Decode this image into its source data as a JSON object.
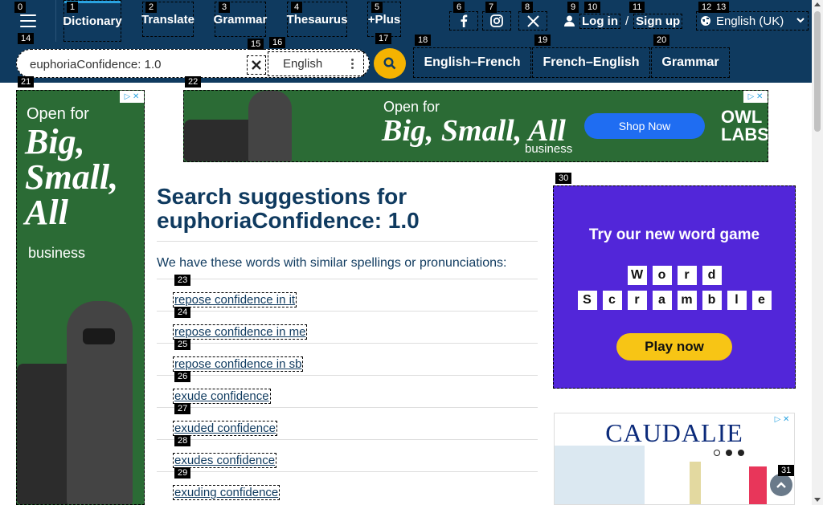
{
  "nav": {
    "items": [
      "Dictionary",
      "Translate",
      "Grammar",
      "Thesaurus",
      "+Plus"
    ],
    "login": "Log in",
    "separator": "/",
    "signup": "Sign up",
    "language": "English (UK)"
  },
  "social": [
    "facebook-icon",
    "instagram-icon",
    "x-icon"
  ],
  "search": {
    "value": "euphoriaConfidence: 1.0",
    "language": "English",
    "directions": [
      "English–French",
      "French–English",
      "Grammar"
    ]
  },
  "ads": {
    "side": {
      "open": "Open for",
      "big": "Big, Small, All",
      "biz": "business"
    },
    "top": {
      "open": "Open for",
      "big": "Big, Small, All",
      "biz": "business",
      "cta": "Shop Now",
      "brand": "OWL LABS."
    },
    "game": {
      "title": "Try our new word game",
      "row1": [
        "W",
        "o",
        "r",
        "d"
      ],
      "row2": [
        "S",
        "c",
        "r",
        "a",
        "m",
        "b",
        "l",
        "e"
      ],
      "cta": "Play now"
    },
    "caudalie": {
      "brand": "CAUDALIE"
    }
  },
  "main": {
    "title_prefix": "Search suggestions for",
    "query": "euphoriaConfidence: 1.0",
    "intro": "We have these words with similar spellings or pronunciations:",
    "suggestions": [
      "repose confidence in it",
      "repose confidence in me",
      "repose confidence in sb",
      "exude confidence",
      "exuded confidence",
      "exudes confidence",
      "exuding confidence"
    ]
  },
  "markers": [
    "0",
    "1",
    "2",
    "3",
    "4",
    "5",
    "6",
    "7",
    "8",
    "9",
    "10",
    "11",
    "12",
    "13",
    "14",
    "15",
    "16",
    "17",
    "18",
    "19",
    "20",
    "21",
    "22",
    "23",
    "24",
    "25",
    "26",
    "27",
    "28",
    "29",
    "30",
    "31"
  ],
  "colors": {
    "header": "#0f3a5f",
    "accent": "#f5b301",
    "link": "#0f3a5f",
    "adGreen": "#2b6b35",
    "gamePurple": "#5226d9"
  }
}
